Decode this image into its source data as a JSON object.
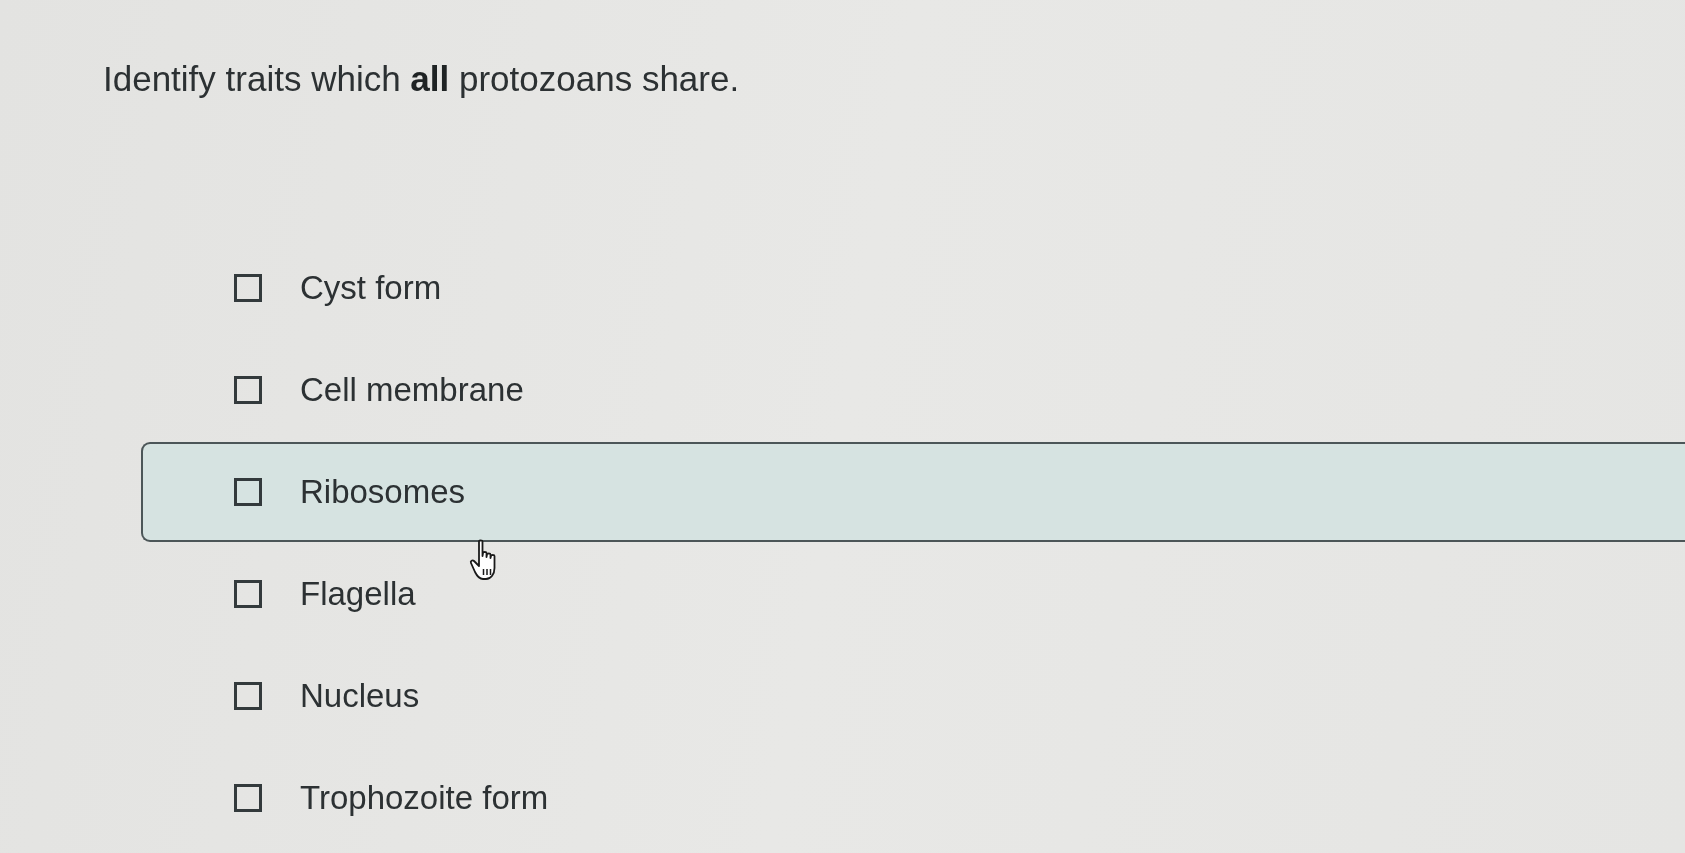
{
  "question": {
    "text": "Identify traits which **all** protozoans share."
  },
  "options": [
    {
      "label": "Cyst form",
      "checked": false,
      "hovered": false
    },
    {
      "label": "Cell membrane",
      "checked": false,
      "hovered": false
    },
    {
      "label": "Ribosomes",
      "checked": false,
      "hovered": true
    },
    {
      "label": "Flagella",
      "checked": false,
      "hovered": false
    },
    {
      "label": "Nucleus",
      "checked": false,
      "hovered": false
    },
    {
      "label": "Trophozoite form",
      "checked": false,
      "hovered": false
    }
  ]
}
